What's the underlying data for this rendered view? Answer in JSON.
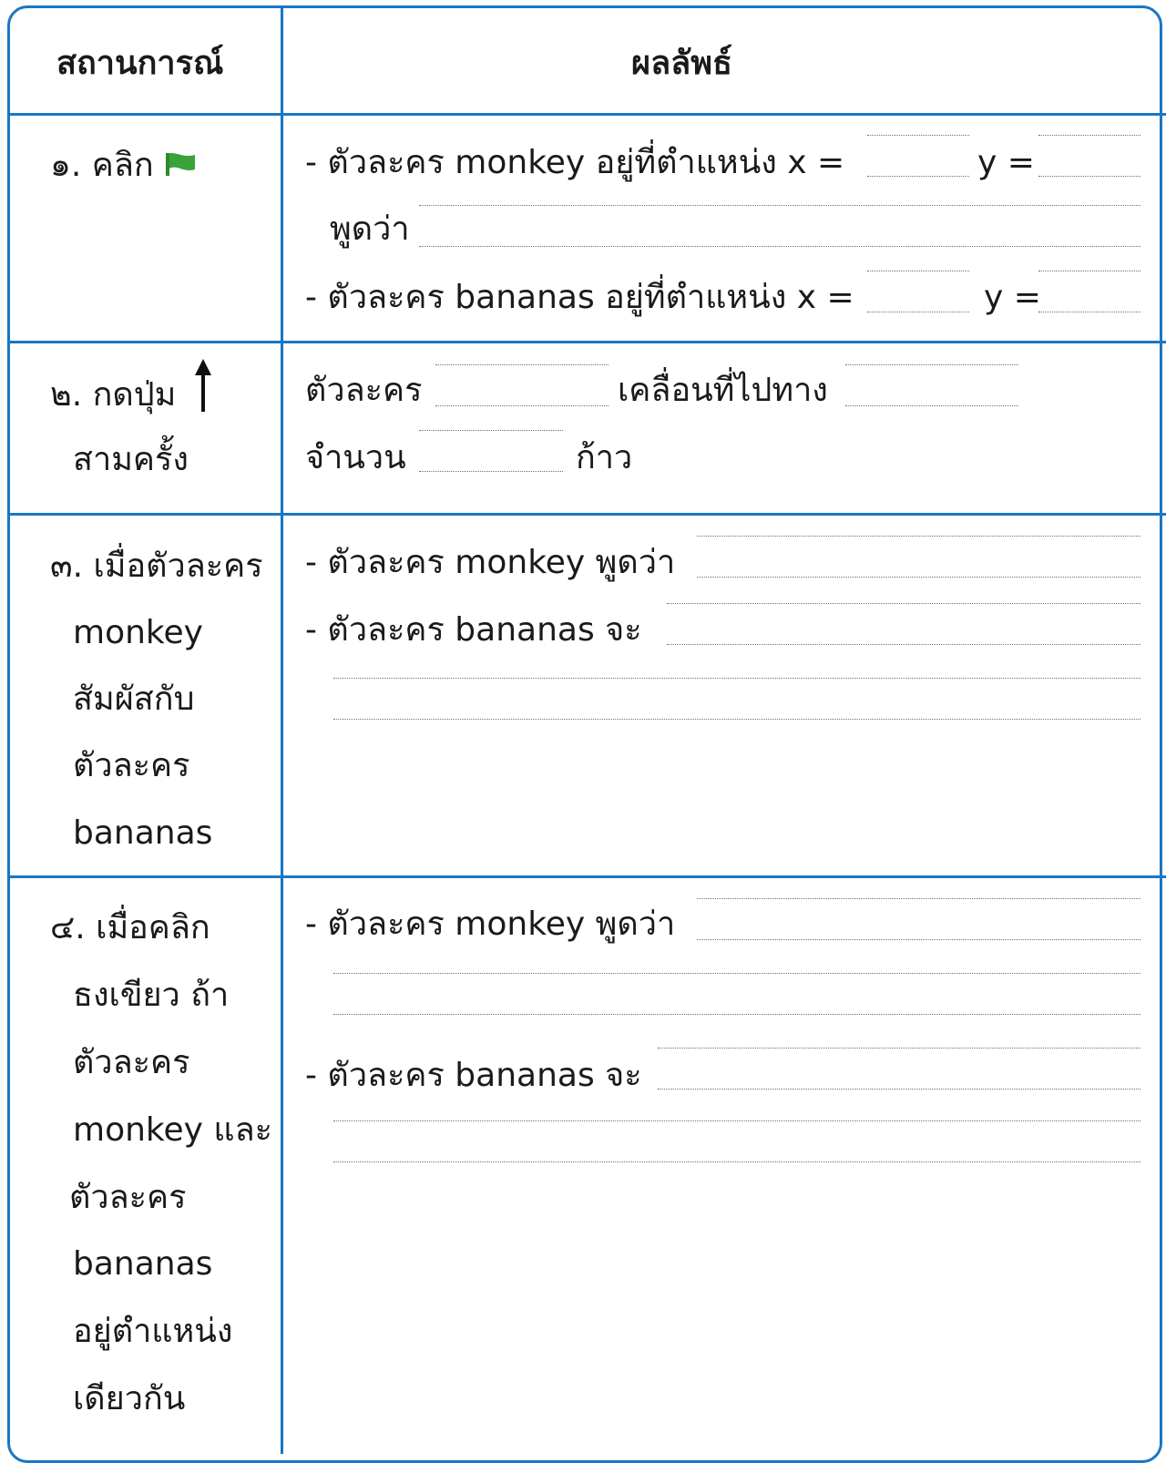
{
  "table": {
    "header": {
      "situation": "สถานการณ์",
      "result": "ผลลัพธ์"
    },
    "rows": [
      {
        "situation_lines": [
          "๑. คลิก"
        ],
        "situation_icon": "green-flag-icon",
        "result_lines": [
          {
            "text": "- ตัวละคร monkey อยู่ที่ตำแหน่ง x =",
            "y_label": "y ="
          },
          {
            "text": "พูดว่า"
          },
          {
            "text": "- ตัวละคร bananas อยู่ที่ตำแหน่ง x =",
            "y_label": "y ="
          }
        ]
      },
      {
        "situation_lines": [
          "๒. กดปุ่ม",
          "สามครั้ง"
        ],
        "situation_icon": "up-arrow-icon",
        "result_lines": [
          {
            "text": "ตัวละคร",
            "middle": "เคลื่อนที่ไปทาง"
          },
          {
            "text": "จำนวน",
            "suffix": "ก้าว"
          }
        ]
      },
      {
        "situation_lines": [
          "๓. เมื่อตัวละคร",
          "monkey",
          "สัมผัสกับ",
          "ตัวละคร",
          "bananas"
        ],
        "result_lines": [
          {
            "text": "- ตัวละคร monkey พูดว่า"
          },
          {
            "text": "- ตัวละคร bananas จะ"
          }
        ]
      },
      {
        "situation_lines": [
          "๔. เมื่อคลิก",
          "ธงเขียว ถ้า",
          "ตัวละคร",
          "monkey และ",
          "ตัวละคร",
          "bananas",
          "อยู่ตำแหน่ง",
          "เดียวกัน"
        ],
        "result_lines": [
          {
            "text": "- ตัวละคร monkey พูดว่า"
          },
          {
            "text": "- ตัวละคร bananas จะ"
          }
        ]
      }
    ]
  },
  "colors": {
    "border": "#1b76c4",
    "flag": "#3aa23a",
    "text": "#1a1a1a",
    "dots": "#707070"
  }
}
